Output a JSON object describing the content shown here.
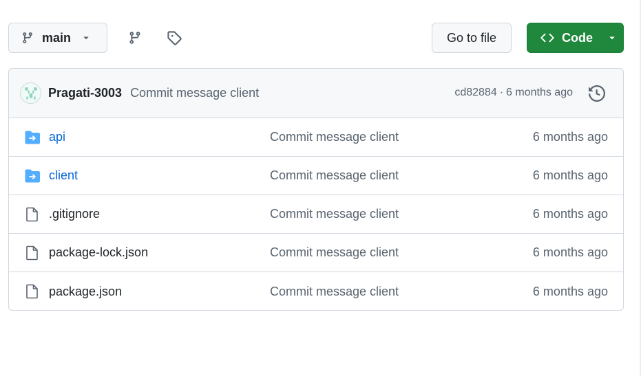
{
  "toolbar": {
    "branch_label": "main",
    "goto_file_label": "Go to file",
    "code_label": "Code"
  },
  "latest_commit": {
    "author": "Pragati-3003",
    "message": "Commit message client",
    "sha": "cd82884",
    "separator": "·",
    "age": "6 months ago"
  },
  "files": [
    {
      "name": "api",
      "type": "directory",
      "commit_message": "Commit message client",
      "age": "6 months ago"
    },
    {
      "name": "client",
      "type": "directory",
      "commit_message": "Commit message client",
      "age": "6 months ago"
    },
    {
      "name": ".gitignore",
      "type": "file",
      "commit_message": "Commit message client",
      "age": "6 months ago"
    },
    {
      "name": "package-lock.json",
      "type": "file",
      "commit_message": "Commit message client",
      "age": "6 months ago"
    },
    {
      "name": "package.json",
      "type": "file",
      "commit_message": "Commit message client",
      "age": "6 months ago"
    }
  ],
  "icons": {
    "branch": "git-branch-icon",
    "caret": "caret-down-icon",
    "branches": "branches-icon",
    "tag": "tag-icon",
    "code": "code-icon",
    "history": "history-icon",
    "directory": "directory-icon",
    "file": "file-icon"
  },
  "colors": {
    "primary_button": "#1f883d",
    "link": "#0969da",
    "directory_icon": "#54aeff",
    "muted_text": "#59636e",
    "border": "#d0d7de",
    "header_bg": "#f6f8fa"
  }
}
